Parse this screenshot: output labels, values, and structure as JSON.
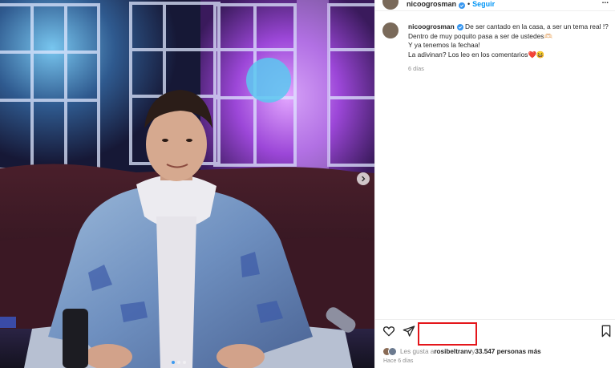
{
  "post": {
    "username": "nicoogrosman",
    "separator": "•",
    "follow_label": "Seguir",
    "more_label": "...",
    "caption": {
      "line1": "De ser cantado en la casa, a ser un tema real !?",
      "line2": "Dentro de muy poquito pasa a ser de ustedes🫶🏻",
      "line3": "Y ya tenemos la fechaa!",
      "line4_text": "La adivinan? Los leo en los comentarios",
      "line4_emoji1": "❤️",
      "line4_emoji2": "😆",
      "time": "6 días"
    },
    "likes": {
      "prefix": "Les gusta a ",
      "user": "rosibeltranv",
      "middle": " y ",
      "count": "33.547 personas más"
    },
    "posted": "Hace 6 días",
    "carousel": {
      "total": 3,
      "active": 0
    }
  },
  "icons": {
    "heart": "heart-icon",
    "share": "send-icon",
    "save": "bookmark-icon",
    "verified": "verified-badge-icon",
    "next": "chevron-right-icon"
  },
  "colors": {
    "follow": "#0095f6",
    "verified": "#3897f0",
    "highlight_box": "#e4161b",
    "carousel_active": "#3d9bf0"
  }
}
